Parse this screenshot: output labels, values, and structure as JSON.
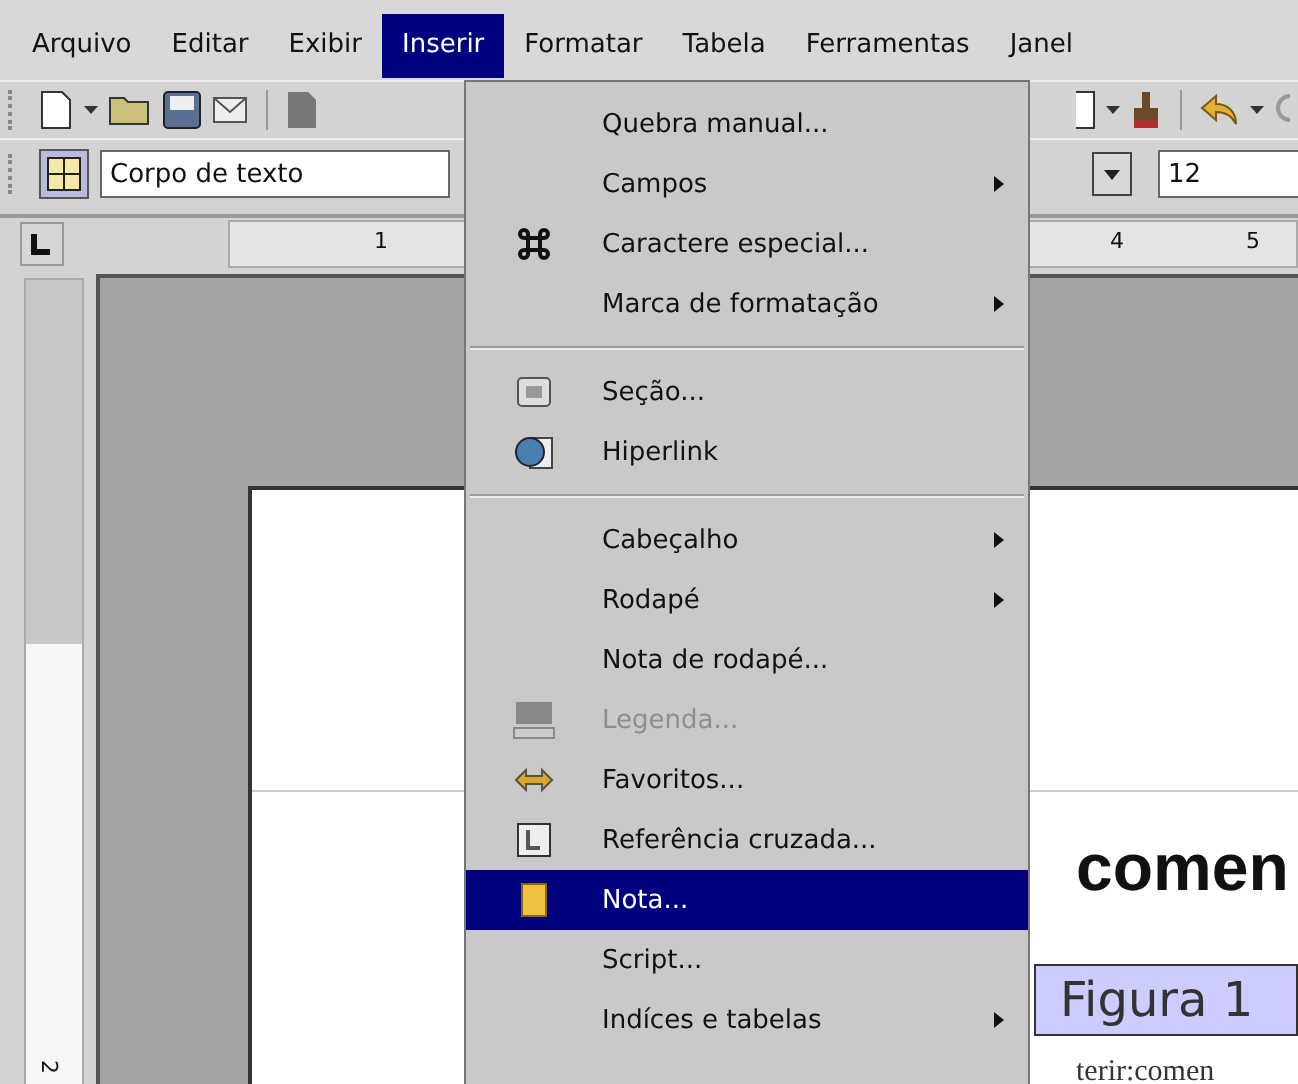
{
  "menubar": [
    {
      "label": "Arquivo",
      "selected": false
    },
    {
      "label": "Editar",
      "selected": false
    },
    {
      "label": "Exibir",
      "selected": false
    },
    {
      "label": "Inserir",
      "selected": true
    },
    {
      "label": "Formatar",
      "selected": false
    },
    {
      "label": "Tabela",
      "selected": false
    },
    {
      "label": "Ferramentas",
      "selected": false
    },
    {
      "label": "Janel",
      "selected": false
    }
  ],
  "formatting": {
    "paragraph_style": "Corpo de texto",
    "font_size": "12"
  },
  "ruler": {
    "numbers": [
      "1",
      "4",
      "5"
    ],
    "vertical_number": "2"
  },
  "menu": {
    "items": [
      {
        "kind": "item",
        "label": "Quebra manual...",
        "submenu": false,
        "disabled": false,
        "selected": false
      },
      {
        "kind": "item",
        "label": "Campos",
        "submenu": true,
        "disabled": false,
        "selected": false
      },
      {
        "kind": "item",
        "label": "Caractere especial...",
        "submenu": false,
        "disabled": false,
        "selected": false
      },
      {
        "kind": "item",
        "label": "Marca de formatação",
        "submenu": true,
        "disabled": false,
        "selected": false
      },
      {
        "kind": "separator"
      },
      {
        "kind": "item",
        "label": "Seção...",
        "submenu": false,
        "disabled": false,
        "selected": false
      },
      {
        "kind": "item",
        "label": "Hiperlink",
        "submenu": false,
        "disabled": false,
        "selected": false
      },
      {
        "kind": "separator"
      },
      {
        "kind": "item",
        "label": "Cabeçalho",
        "submenu": true,
        "disabled": false,
        "selected": false
      },
      {
        "kind": "item",
        "label": "Rodapé",
        "submenu": true,
        "disabled": false,
        "selected": false
      },
      {
        "kind": "item",
        "label": "Nota de rodapé...",
        "submenu": false,
        "disabled": false,
        "selected": false
      },
      {
        "kind": "item",
        "label": "Legenda...",
        "submenu": false,
        "disabled": true,
        "selected": false
      },
      {
        "kind": "item",
        "label": "Favoritos...",
        "submenu": false,
        "disabled": false,
        "selected": false
      },
      {
        "kind": "item",
        "label": "Referência cruzada...",
        "submenu": false,
        "disabled": false,
        "selected": false
      },
      {
        "kind": "item",
        "label": "Nota...",
        "submenu": false,
        "disabled": false,
        "selected": true
      },
      {
        "kind": "item",
        "label": "Script...",
        "submenu": false,
        "disabled": false,
        "selected": false
      },
      {
        "kind": "item",
        "label": "Indíces e tabelas",
        "submenu": true,
        "disabled": false,
        "selected": false
      }
    ]
  },
  "document": {
    "heading": "comen",
    "body_text": "terir:comen"
  },
  "caption": "Figura 1"
}
